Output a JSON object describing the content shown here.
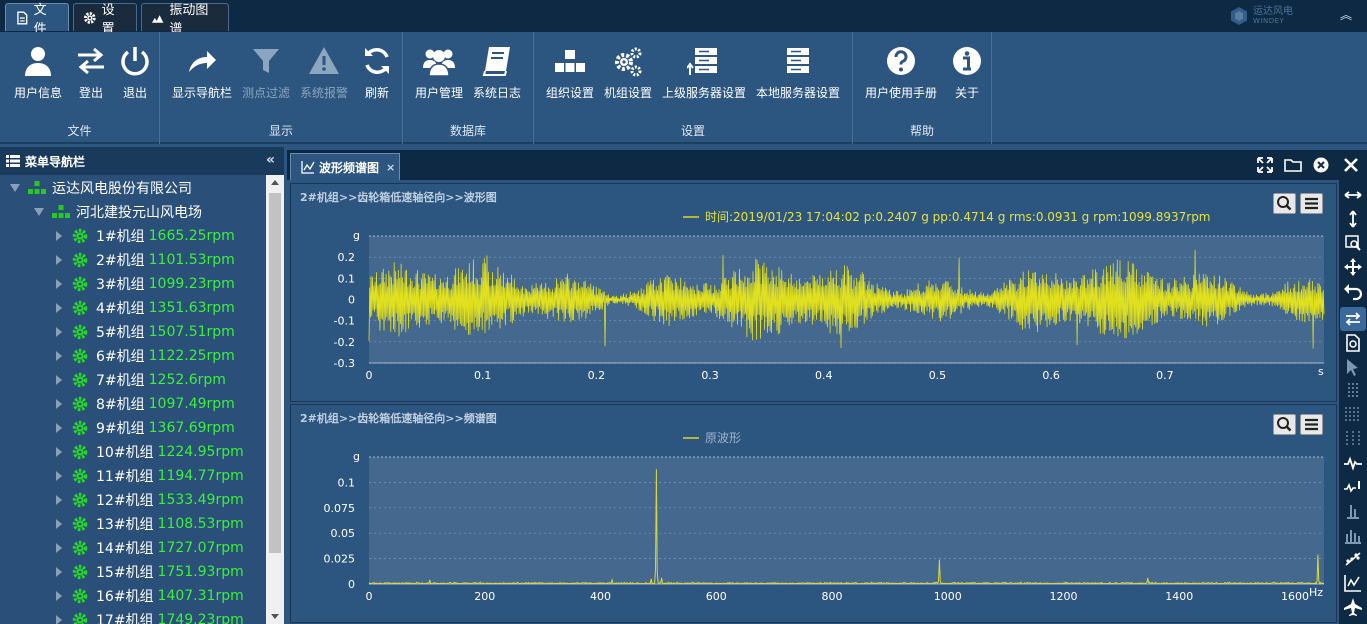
{
  "tabs": [
    {
      "label": "文件"
    },
    {
      "label": "设置"
    },
    {
      "label": "振动图谱"
    }
  ],
  "logo": {
    "name": "运达风电",
    "sub": "WINDEY"
  },
  "ribbon": {
    "groups": [
      {
        "label": "文件"
      },
      {
        "label": "显示"
      },
      {
        "label": "数据库"
      },
      {
        "label": "设置"
      },
      {
        "label": "帮助"
      }
    ],
    "buttons": [
      {
        "label": "用户信息",
        "icon": "user-icon"
      },
      {
        "label": "登出",
        "icon": "swap-icon"
      },
      {
        "label": "退出",
        "icon": "power-icon"
      },
      {
        "label": "显示导航栏",
        "icon": "share-arrow-icon"
      },
      {
        "label": "测点过滤",
        "icon": "filter-icon"
      },
      {
        "label": "系统报警",
        "icon": "warning-icon"
      },
      {
        "label": "刷新",
        "icon": "refresh-icon"
      },
      {
        "label": "用户管理",
        "icon": "users-icon"
      },
      {
        "label": "系统日志",
        "icon": "book-icon"
      },
      {
        "label": "组织设置",
        "icon": "org-icon"
      },
      {
        "label": "机组设置",
        "icon": "gears-icon"
      },
      {
        "label": "上级服务器设置",
        "icon": "server-up-icon"
      },
      {
        "label": "本地服务器设置",
        "icon": "server-icon"
      },
      {
        "label": "用户使用手册",
        "icon": "question-icon"
      },
      {
        "label": "关于",
        "icon": "info-icon"
      }
    ]
  },
  "nav": {
    "title": "菜单导航栏",
    "company": "运达风电股份有限公司",
    "farm": "河北建投元山风电场",
    "units": [
      {
        "name": "1#机组",
        "rpm": "1665.25rpm"
      },
      {
        "name": "2#机组",
        "rpm": "1101.53rpm"
      },
      {
        "name": "3#机组",
        "rpm": "1099.23rpm"
      },
      {
        "name": "4#机组",
        "rpm": "1351.63rpm"
      },
      {
        "name": "5#机组",
        "rpm": "1507.51rpm"
      },
      {
        "name": "6#机组",
        "rpm": "1122.25rpm"
      },
      {
        "name": "7#机组",
        "rpm": "1252.6rpm"
      },
      {
        "name": "8#机组",
        "rpm": "1097.49rpm"
      },
      {
        "name": "9#机组",
        "rpm": "1367.69rpm"
      },
      {
        "name": "10#机组",
        "rpm": "1224.95rpm"
      },
      {
        "name": "11#机组",
        "rpm": "1194.77rpm"
      },
      {
        "name": "12#机组",
        "rpm": "1533.49rpm"
      },
      {
        "name": "13#机组",
        "rpm": "1108.53rpm"
      },
      {
        "name": "14#机组",
        "rpm": "1727.07rpm"
      },
      {
        "name": "15#机组",
        "rpm": "1751.93rpm"
      },
      {
        "name": "16#机组",
        "rpm": "1407.31rpm"
      },
      {
        "name": "17#机组",
        "rpm": "1749.23rpm"
      }
    ]
  },
  "doc": {
    "tab": "波形频谱图"
  },
  "chart_data": [
    {
      "type": "line",
      "title": "2#机组>>齿轮箱低速轴径向>>波形图",
      "legend": "时间:2019/01/23 17:04:02 p:0.2407 g pp:0.4714 g rms:0.0931 g rpm:1099.8937rpm",
      "ylabel": "g",
      "xlabel": "s",
      "xlim": [
        0,
        0.84
      ],
      "ylim": [
        -0.3,
        0.3
      ],
      "xticks": [
        "0",
        "0.1",
        "0.2",
        "0.3",
        "0.4",
        "0.5",
        "0.6",
        "0.7"
      ],
      "yticks": [
        "0.2",
        "0.1",
        "0",
        "-0.1",
        "-0.2",
        "-0.3"
      ],
      "series": [
        {
          "amplitude_rms": 0.0931,
          "peak": 0.2407,
          "color": "#e0e01e"
        }
      ]
    },
    {
      "type": "line",
      "title": "2#机组>>齿轮箱低速轴径向>>频谱图",
      "legend": "原波形",
      "ylabel": "g",
      "xlabel": "Hz",
      "xlim": [
        0,
        1650
      ],
      "ylim": [
        0,
        0.125
      ],
      "xticks": [
        "0",
        "200",
        "400",
        "600",
        "800",
        "1000",
        "1200",
        "1400",
        "1600"
      ],
      "yticks": [
        "0.1",
        "0.075",
        "0.05",
        "0.025",
        "0"
      ],
      "peaks": [
        {
          "x": 496,
          "y": 0.113
        },
        {
          "x": 985,
          "y": 0.024
        },
        {
          "x": 1640,
          "y": 0.029
        },
        {
          "x": 488,
          "y": 0.005
        },
        {
          "x": 505,
          "y": 0.006
        },
        {
          "x": 1345,
          "y": 0.006
        },
        {
          "x": 105,
          "y": 0.004
        },
        {
          "x": 420,
          "y": 0.004
        }
      ],
      "series": [
        {
          "color": "#d8d83a"
        }
      ]
    }
  ]
}
